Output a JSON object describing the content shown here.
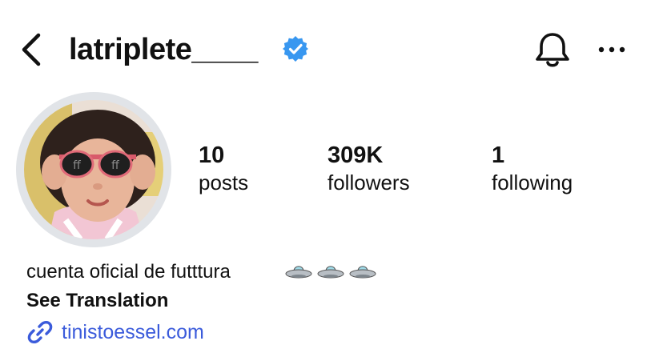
{
  "header": {
    "username": "latriplete____",
    "icons": {
      "back": "chevron-left-icon",
      "verified": "verified-badge-icon",
      "bell": "bell-icon",
      "more": "ellipsis-icon"
    }
  },
  "stats": [
    {
      "value": "10",
      "label": "posts"
    },
    {
      "value": "309K",
      "label": "followers"
    },
    {
      "value": "1",
      "label": "following"
    }
  ],
  "bio": {
    "text": "cuenta oficial de futttura",
    "emoji": [
      "ufo",
      "ufo",
      "ufo"
    ],
    "see_translation": "See Translation",
    "link": "tinistoessel.com"
  },
  "colors": {
    "verified": "#3897f0",
    "link": "#3b5bdb",
    "avatar_ring": "#e1e4e8"
  }
}
